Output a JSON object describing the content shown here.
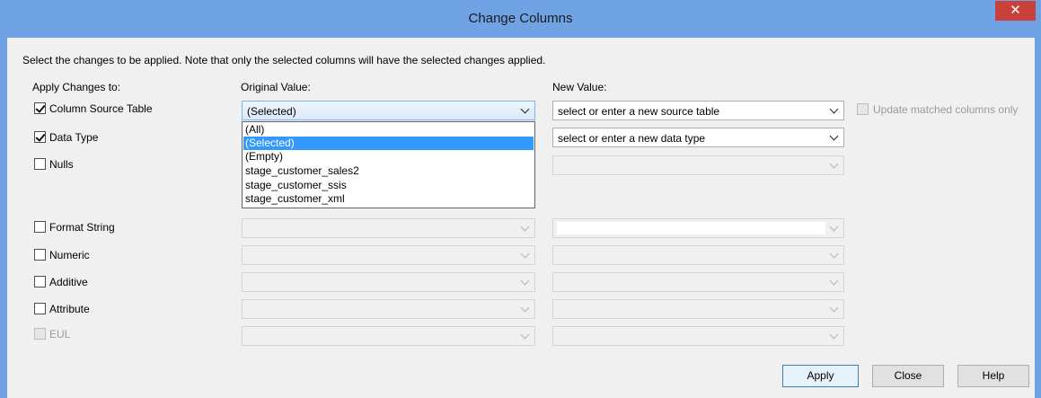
{
  "window": {
    "title": "Change Columns",
    "close_glyph": "✕"
  },
  "instruction": "Select the changes to be applied. Note that only the selected columns will have the selected changes applied.",
  "headers": {
    "apply": "Apply Changes to:",
    "original": "Original Value:",
    "new": "New Value:"
  },
  "rows": [
    {
      "label": "Column Source Table",
      "checked": true,
      "original": "(Selected)",
      "new": "select or enter a new source table"
    },
    {
      "label": "Data Type",
      "checked": true,
      "original": "",
      "new": "select or enter a new data type"
    },
    {
      "label": "Nulls",
      "checked": false,
      "original": "",
      "new": ""
    },
    {
      "label": "Format String",
      "checked": false,
      "original": "",
      "new": ""
    },
    {
      "label": "Numeric",
      "checked": false,
      "original": "",
      "new": ""
    },
    {
      "label": "Additive",
      "checked": false,
      "original": "",
      "new": ""
    },
    {
      "label": "Attribute",
      "checked": false,
      "original": "",
      "new": ""
    },
    {
      "label": "EUL",
      "checked": false,
      "original": "",
      "new": "",
      "disabled": true
    }
  ],
  "update_matched": {
    "label": "Update matched columns only",
    "checked": false,
    "enabled": false
  },
  "dropdown_options": [
    "(All)",
    "(Selected)",
    "(Empty)",
    "stage_customer_sales2",
    "stage_customer_ssis",
    "stage_customer_xml"
  ],
  "dropdown_selected": "(Selected)",
  "buttons": {
    "apply": "Apply",
    "close": "Close",
    "help": "Help"
  },
  "colors": {
    "titlebar": "#6fa3e6",
    "close_button": "#c8413a",
    "highlight": "#3399ff",
    "dialog_bg": "#f0f0f0"
  }
}
